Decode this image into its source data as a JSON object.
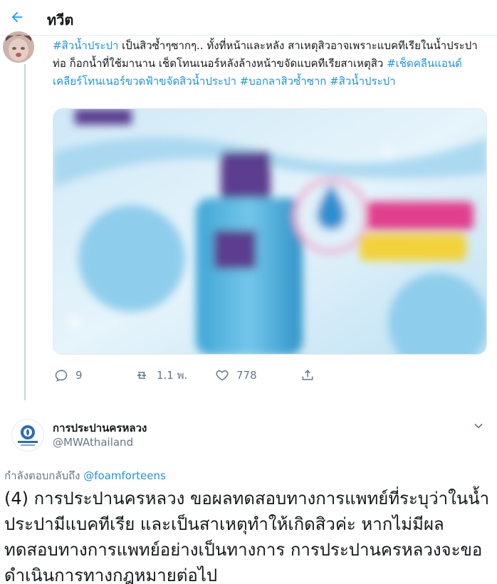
{
  "header": {
    "title": "ทวีต",
    "back_icon": "arrow-left-icon",
    "accent": "#1da1f2"
  },
  "tweet": {
    "text_parts": [
      {
        "type": "hashtag",
        "text": "#สิวน้ำประปา"
      },
      {
        "type": "text",
        "text": " เป็นสิวซ้ำๆซากๆ.. ทั้งที่หน้าและหลัง สาเหตุสิวอาจเพราะแบคทีเรียในน้ำประปา ท่อ ก็อกน้ำที่ใช้มานาน เช็ดโทนเนอร์หลังล้างหน้าขจัดแบคทีเรียสาเหตุสิว "
      },
      {
        "type": "hashtag",
        "text": "#เช็ดคลีนแอนด์เคลียร์โทนเนอร์ขวดฟ้าขจัดสิวน้ำประปา"
      },
      {
        "type": "text",
        "text": " "
      },
      {
        "type": "hashtag",
        "text": "#บอกลาสิวซ้ำซาก"
      },
      {
        "type": "text",
        "text": " "
      },
      {
        "type": "hashtag",
        "text": "#สิวน้ำประปา"
      }
    ],
    "hashtag_color": "#1b95e0",
    "media_icon": "blurred-product-image",
    "actions": {
      "reply_count": "9",
      "retweet_count": "1.1 พ.",
      "like_count": "778"
    }
  },
  "reply": {
    "name": "การประปานครหลวง",
    "handle": "@MWAthailand",
    "replying_prefix": "กำลังตอบกลับถึง ",
    "replying_to": "@foamforteens",
    "text": "(4) การประปานครหลวง ขอผลทดสอบทางการแพทย์ที่ระบุว่าในน้ำประปามีแบคทีเรีย และเป็นสาเหตุทำให้เกิดสิวค่ะ หากไม่มีผลทดสอบทางการแพทย์อย่างเป็นทางการ การประปานครหลวงจะขอดำเนินการทางกฎหมายต่อไป"
  }
}
